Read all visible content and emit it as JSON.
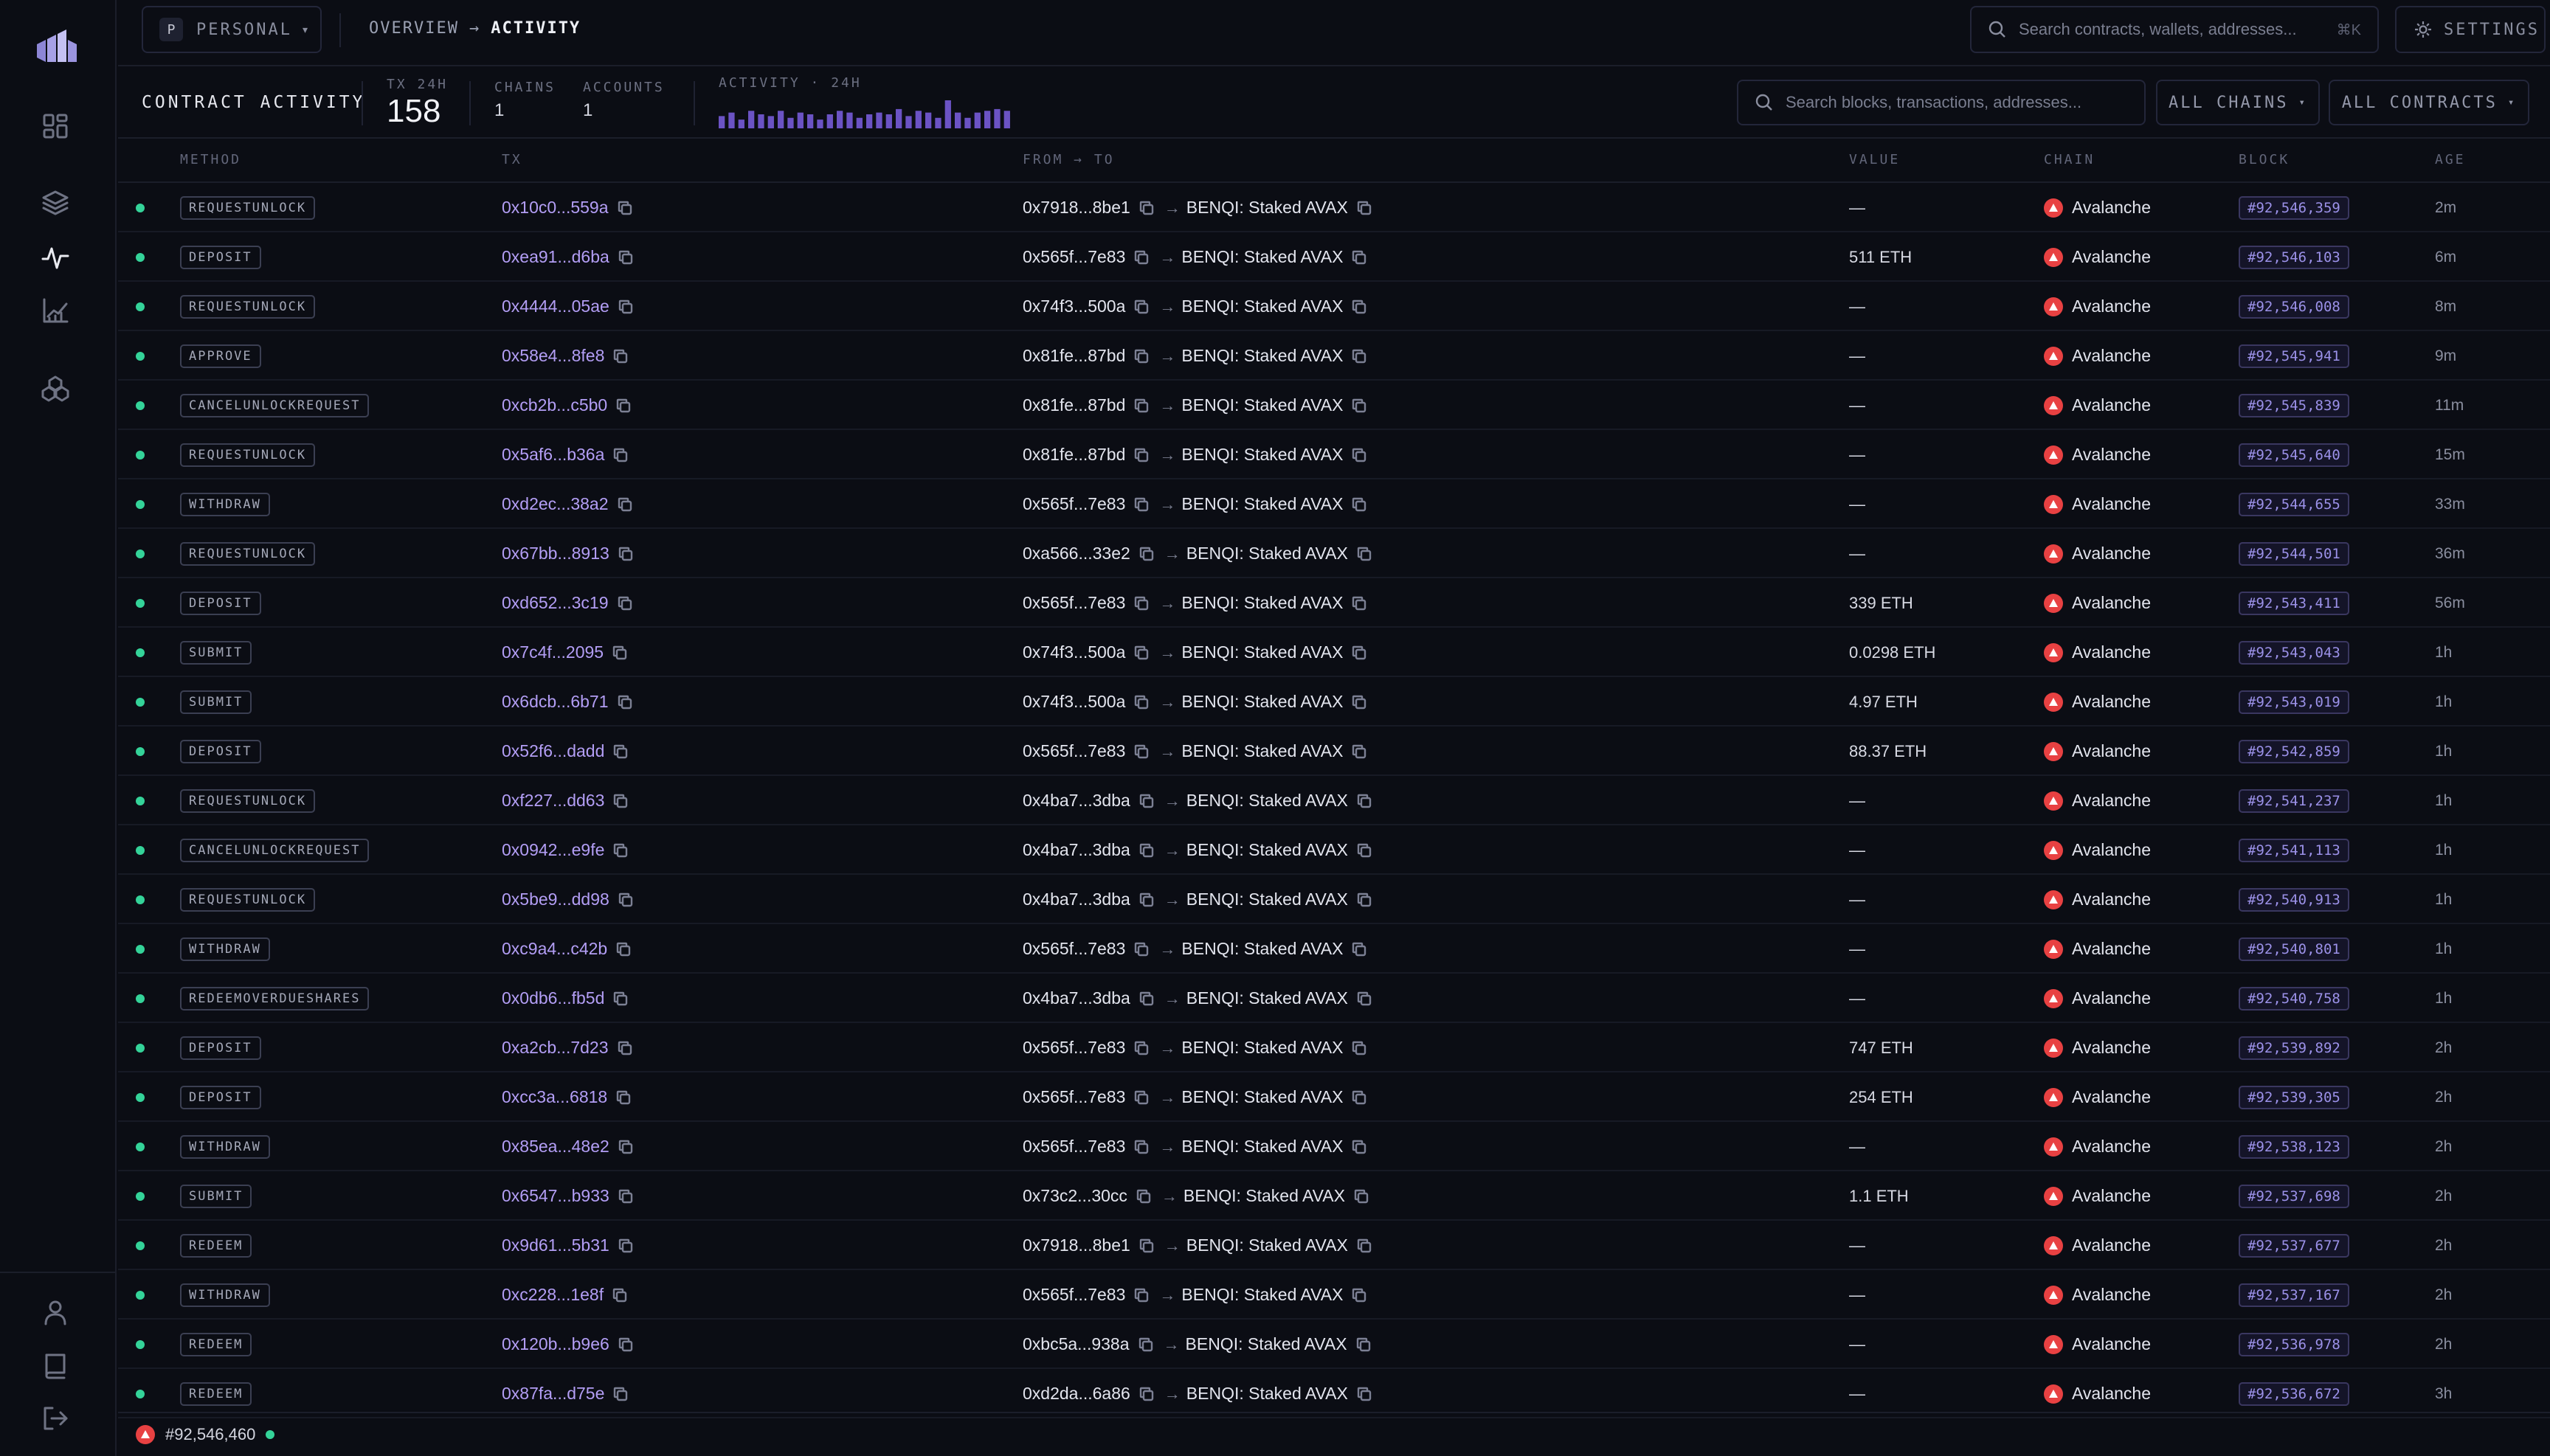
{
  "workspace": {
    "avatar": "P",
    "label": "PERSONAL"
  },
  "breadcrumb": {
    "parent": "OVERVIEW",
    "separator": "→",
    "current": "ACTIVITY"
  },
  "top_search": {
    "placeholder": "Search contracts, wallets, addresses...",
    "shortcut": "⌘K"
  },
  "settings_label": "SETTINGS",
  "sidebar": {
    "nav": [
      "dashboard-icon",
      "layers-icon",
      "activity-icon",
      "chart-icon",
      "cluster-icon"
    ],
    "bottom": [
      "user-icon",
      "book-icon",
      "logout-icon"
    ]
  },
  "subheader": {
    "title": "CONTRACT ACTIVITY",
    "tx_label": "TX 24H",
    "tx_value": "158",
    "chains_label": "CHAINS",
    "chains_value": "1",
    "accounts_label": "ACCOUNTS",
    "accounts_value": "1",
    "activity_label": "ACTIVITY · 24H",
    "activity_bars": [
      7,
      9,
      5,
      10,
      8,
      7,
      10,
      6,
      9,
      8,
      5,
      8,
      10,
      9,
      6,
      8,
      9,
      8,
      11,
      7,
      10,
      9,
      6,
      16,
      9,
      6,
      9,
      10,
      11,
      10
    ],
    "search_placeholder": "Search blocks, transactions, addresses...",
    "filter_chains": "ALL CHAINS",
    "filter_contracts": "ALL CONTRACTS"
  },
  "table": {
    "headers": {
      "method": "METHOD",
      "tx": "TX",
      "from_to": "FROM → TO",
      "value": "VALUE",
      "chain": "CHAIN",
      "block": "BLOCK",
      "age": "AGE"
    },
    "rows": [
      {
        "method": "REQUESTUNLOCK",
        "tx": "0x10c0...559a",
        "from": "0x7918...8be1",
        "to": "BENQI: Staked AVAX",
        "value": "—",
        "chain": "Avalanche",
        "block": "#92,546,359",
        "age": "2m"
      },
      {
        "method": "DEPOSIT",
        "tx": "0xea91...d6ba",
        "from": "0x565f...7e83",
        "to": "BENQI: Staked AVAX",
        "value": "511 ETH",
        "chain": "Avalanche",
        "block": "#92,546,103",
        "age": "6m"
      },
      {
        "method": "REQUESTUNLOCK",
        "tx": "0x4444...05ae",
        "from": "0x74f3...500a",
        "to": "BENQI: Staked AVAX",
        "value": "—",
        "chain": "Avalanche",
        "block": "#92,546,008",
        "age": "8m"
      },
      {
        "method": "APPROVE",
        "tx": "0x58e4...8fe8",
        "from": "0x81fe...87bd",
        "to": "BENQI: Staked AVAX",
        "value": "—",
        "chain": "Avalanche",
        "block": "#92,545,941",
        "age": "9m"
      },
      {
        "method": "CANCELUNLOCKREQUEST",
        "tx": "0xcb2b...c5b0",
        "from": "0x81fe...87bd",
        "to": "BENQI: Staked AVAX",
        "value": "—",
        "chain": "Avalanche",
        "block": "#92,545,839",
        "age": "11m"
      },
      {
        "method": "REQUESTUNLOCK",
        "tx": "0x5af6...b36a",
        "from": "0x81fe...87bd",
        "to": "BENQI: Staked AVAX",
        "value": "—",
        "chain": "Avalanche",
        "block": "#92,545,640",
        "age": "15m"
      },
      {
        "method": "WITHDRAW",
        "tx": "0xd2ec...38a2",
        "from": "0x565f...7e83",
        "to": "BENQI: Staked AVAX",
        "value": "—",
        "chain": "Avalanche",
        "block": "#92,544,655",
        "age": "33m"
      },
      {
        "method": "REQUESTUNLOCK",
        "tx": "0x67bb...8913",
        "from": "0xa566...33e2",
        "to": "BENQI: Staked AVAX",
        "value": "—",
        "chain": "Avalanche",
        "block": "#92,544,501",
        "age": "36m"
      },
      {
        "method": "DEPOSIT",
        "tx": "0xd652...3c19",
        "from": "0x565f...7e83",
        "to": "BENQI: Staked AVAX",
        "value": "339 ETH",
        "chain": "Avalanche",
        "block": "#92,543,411",
        "age": "56m"
      },
      {
        "method": "SUBMIT",
        "tx": "0x7c4f...2095",
        "from": "0x74f3...500a",
        "to": "BENQI: Staked AVAX",
        "value": "0.0298 ETH",
        "chain": "Avalanche",
        "block": "#92,543,043",
        "age": "1h"
      },
      {
        "method": "SUBMIT",
        "tx": "0x6dcb...6b71",
        "from": "0x74f3...500a",
        "to": "BENQI: Staked AVAX",
        "value": "4.97 ETH",
        "chain": "Avalanche",
        "block": "#92,543,019",
        "age": "1h"
      },
      {
        "method": "DEPOSIT",
        "tx": "0x52f6...dadd",
        "from": "0x565f...7e83",
        "to": "BENQI: Staked AVAX",
        "value": "88.37 ETH",
        "chain": "Avalanche",
        "block": "#92,542,859",
        "age": "1h"
      },
      {
        "method": "REQUESTUNLOCK",
        "tx": "0xf227...dd63",
        "from": "0x4ba7...3dba",
        "to": "BENQI: Staked AVAX",
        "value": "—",
        "chain": "Avalanche",
        "block": "#92,541,237",
        "age": "1h"
      },
      {
        "method": "CANCELUNLOCKREQUEST",
        "tx": "0x0942...e9fe",
        "from": "0x4ba7...3dba",
        "to": "BENQI: Staked AVAX",
        "value": "—",
        "chain": "Avalanche",
        "block": "#92,541,113",
        "age": "1h"
      },
      {
        "method": "REQUESTUNLOCK",
        "tx": "0x5be9...dd98",
        "from": "0x4ba7...3dba",
        "to": "BENQI: Staked AVAX",
        "value": "—",
        "chain": "Avalanche",
        "block": "#92,540,913",
        "age": "1h"
      },
      {
        "method": "WITHDRAW",
        "tx": "0xc9a4...c42b",
        "from": "0x565f...7e83",
        "to": "BENQI: Staked AVAX",
        "value": "—",
        "chain": "Avalanche",
        "block": "#92,540,801",
        "age": "1h"
      },
      {
        "method": "REDEEMOVERDUESHARES",
        "tx": "0x0db6...fb5d",
        "from": "0x4ba7...3dba",
        "to": "BENQI: Staked AVAX",
        "value": "—",
        "chain": "Avalanche",
        "block": "#92,540,758",
        "age": "1h"
      },
      {
        "method": "DEPOSIT",
        "tx": "0xa2cb...7d23",
        "from": "0x565f...7e83",
        "to": "BENQI: Staked AVAX",
        "value": "747 ETH",
        "chain": "Avalanche",
        "block": "#92,539,892",
        "age": "2h"
      },
      {
        "method": "DEPOSIT",
        "tx": "0xcc3a...6818",
        "from": "0x565f...7e83",
        "to": "BENQI: Staked AVAX",
        "value": "254 ETH",
        "chain": "Avalanche",
        "block": "#92,539,305",
        "age": "2h"
      },
      {
        "method": "WITHDRAW",
        "tx": "0x85ea...48e2",
        "from": "0x565f...7e83",
        "to": "BENQI: Staked AVAX",
        "value": "—",
        "chain": "Avalanche",
        "block": "#92,538,123",
        "age": "2h"
      },
      {
        "method": "SUBMIT",
        "tx": "0x6547...b933",
        "from": "0x73c2...30cc",
        "to": "BENQI: Staked AVAX",
        "value": "1.1 ETH",
        "chain": "Avalanche",
        "block": "#92,537,698",
        "age": "2h"
      },
      {
        "method": "REDEEM",
        "tx": "0x9d61...5b31",
        "from": "0x7918...8be1",
        "to": "BENQI: Staked AVAX",
        "value": "—",
        "chain": "Avalanche",
        "block": "#92,537,677",
        "age": "2h"
      },
      {
        "method": "WITHDRAW",
        "tx": "0xc228...1e8f",
        "from": "0x565f...7e83",
        "to": "BENQI: Staked AVAX",
        "value": "—",
        "chain": "Avalanche",
        "block": "#92,537,167",
        "age": "2h"
      },
      {
        "method": "REDEEM",
        "tx": "0x120b...b9e6",
        "from": "0xbc5a...938a",
        "to": "BENQI: Staked AVAX",
        "value": "—",
        "chain": "Avalanche",
        "block": "#92,536,978",
        "age": "2h"
      },
      {
        "method": "REDEEM",
        "tx": "0x87fa...d75e",
        "from": "0xd2da...6a86",
        "to": "BENQI: Staked AVAX",
        "value": "—",
        "chain": "Avalanche",
        "block": "#92,536,672",
        "age": "3h"
      }
    ]
  },
  "footer": {
    "latest_block": "#92,546,460"
  },
  "colors": {
    "accent": "#b39ef5",
    "status": "#34d399",
    "avalanche": "#e84142",
    "background": "#0b0d14"
  }
}
